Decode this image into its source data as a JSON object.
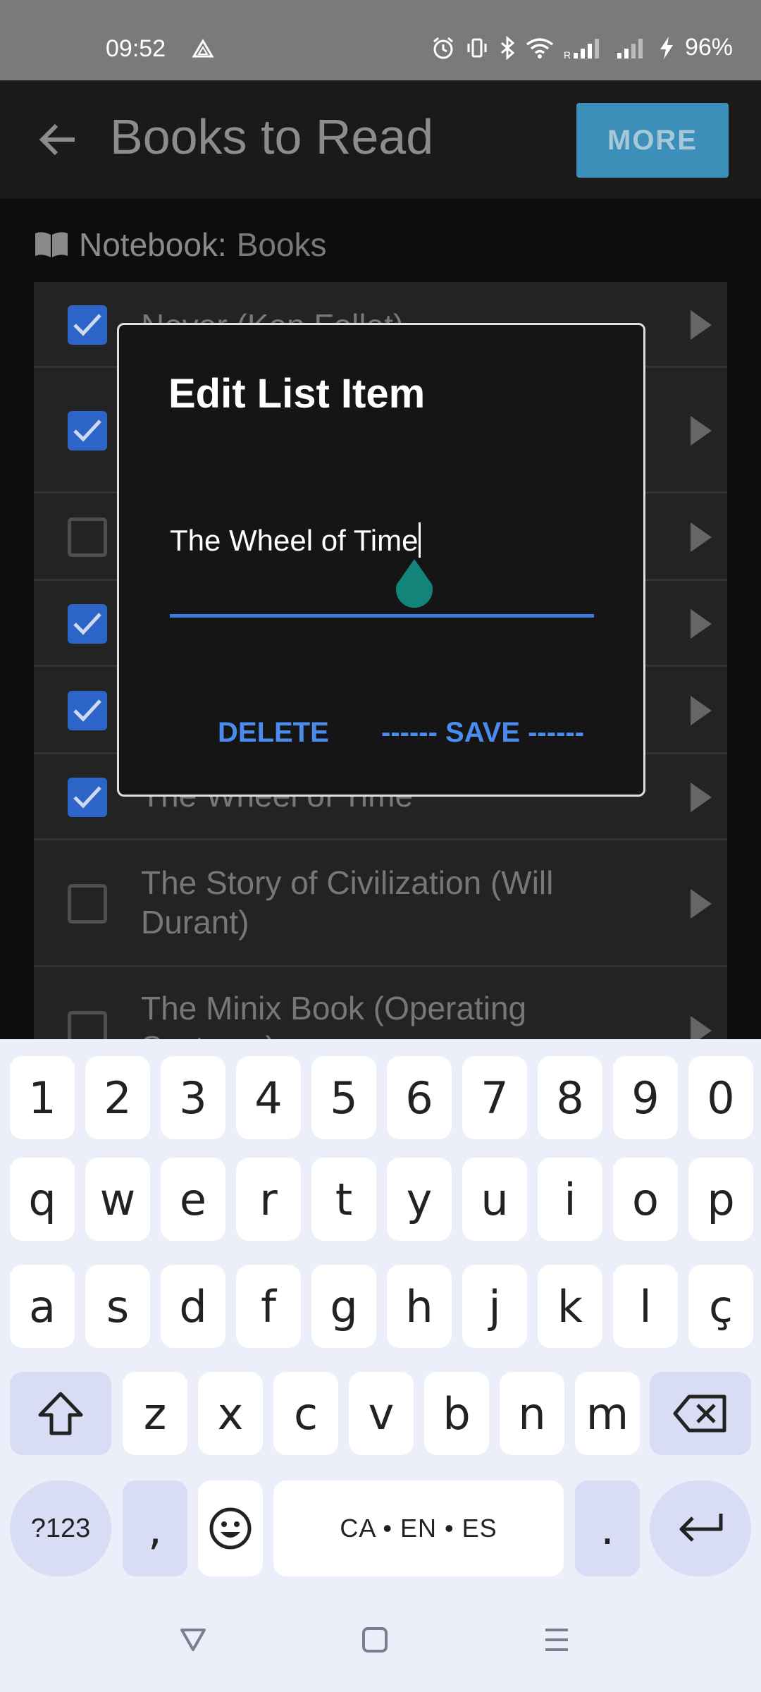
{
  "status_bar": {
    "time": "09:52",
    "battery": "96%",
    "icons": [
      "cloud-drive-icon",
      "alarm-icon",
      "vibrate-icon",
      "bluetooth-icon",
      "wifi-icon",
      "signal-r-icon",
      "signal-icon",
      "charging-icon"
    ]
  },
  "header": {
    "title": "Books to Read",
    "more_label": "MORE",
    "accent_color": "#3b8fb8"
  },
  "notebook": {
    "label": "Notebook:",
    "value": "Books"
  },
  "list": {
    "items": [
      {
        "text": "Never (Ken Follet)",
        "checked": true
      },
      {
        "text": "",
        "checked": true
      },
      {
        "text": "",
        "checked": false
      },
      {
        "text": "",
        "checked": true
      },
      {
        "text": "",
        "checked": true
      },
      {
        "text": "The Wheel of Time",
        "checked": true
      },
      {
        "text": "The Story of Civilization (Will Durant)",
        "checked": false
      },
      {
        "text": "The Minix Book (Operating Systems)",
        "checked": false
      }
    ]
  },
  "dialog": {
    "title": "Edit List Item",
    "input_value": "The Wheel of Time",
    "delete_label": "DELETE",
    "save_label": "------ SAVE ------",
    "accent_color": "#3c7de3"
  },
  "keyboard": {
    "number_row": [
      "1",
      "2",
      "3",
      "4",
      "5",
      "6",
      "7",
      "8",
      "9",
      "0"
    ],
    "row1": [
      "q",
      "w",
      "e",
      "r",
      "t",
      "y",
      "u",
      "i",
      "o",
      "p"
    ],
    "row2": [
      "a",
      "s",
      "d",
      "f",
      "g",
      "h",
      "j",
      "k",
      "l",
      "ç"
    ],
    "row3": [
      "z",
      "x",
      "c",
      "v",
      "b",
      "n",
      "m"
    ],
    "symbols_label": "?123",
    "comma": ",",
    "period": ".",
    "space_label": "CA • EN • ES"
  }
}
